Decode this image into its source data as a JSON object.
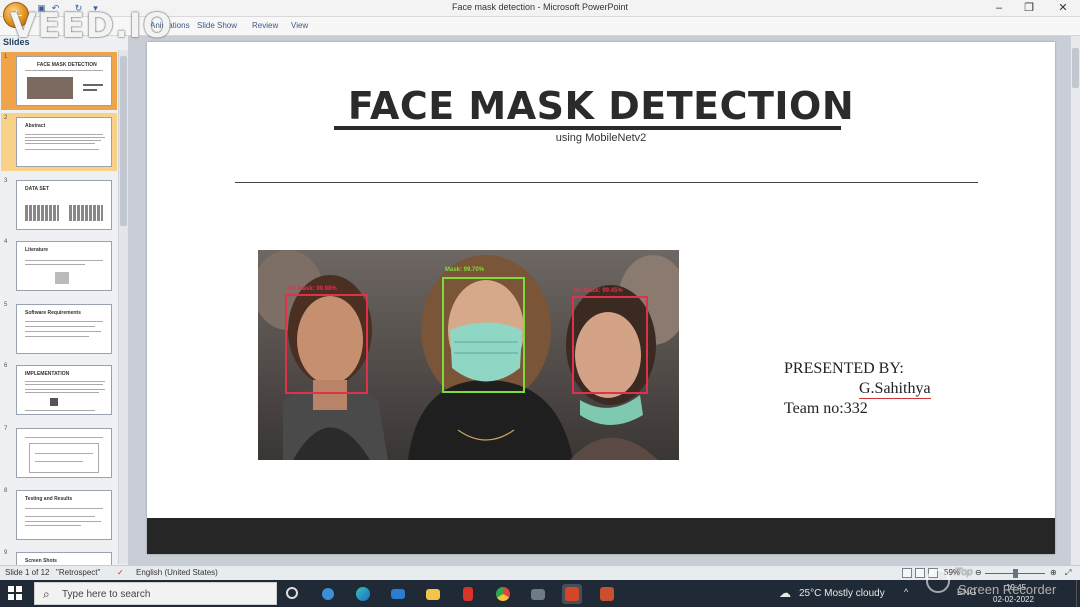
{
  "window": {
    "title": "Face mask detection - Microsoft PowerPoint",
    "controls": [
      "minimize-icon",
      "restore-icon",
      "close-icon"
    ]
  },
  "ribbon": {
    "tabs": [
      {
        "label": "Animations"
      },
      {
        "label": "Slide Show"
      },
      {
        "label": "Review"
      },
      {
        "label": "View"
      }
    ],
    "watermark": "VEED.IO"
  },
  "slide_panel": {
    "tab_label": "Slides",
    "thumbnails": [
      {
        "num": "1",
        "title": "FACE MASK DETECTION"
      },
      {
        "num": "2",
        "title": "Abstract"
      },
      {
        "num": "3",
        "title": "DATA SET"
      },
      {
        "num": "4",
        "title": "Literature"
      },
      {
        "num": "5",
        "title": "Software Requirements"
      },
      {
        "num": "6",
        "title": "IMPLEMENTATION"
      },
      {
        "num": "7",
        "title": ""
      },
      {
        "num": "8",
        "title": "Testing and Results"
      },
      {
        "num": "9",
        "title": "Screen Shots"
      }
    ]
  },
  "slide": {
    "title": "FACE MASK DETECTION",
    "subtitle": "using MobileNetv2",
    "presented_by": "PRESENTED BY:",
    "presenter": "G.Sahithya",
    "team": "Team no:332",
    "image": {
      "boxes": [
        {
          "label": "No Mask: 99.98%",
          "color": "#e0314b"
        },
        {
          "label": "Mask: 99.70%",
          "color": "#7ddc3a"
        },
        {
          "label": "No Mask: 99.45%",
          "color": "#e0314b"
        }
      ]
    }
  },
  "status_bar": {
    "slide_counter": "Slide 1 of 12",
    "theme": "\"Retrospect\"",
    "language": "English (United States)",
    "zoom": "59%"
  },
  "taskbar": {
    "search_placeholder": "Type here to search",
    "weather": "25°C  Mostly cloudy",
    "language": "ENG",
    "time": "19:45",
    "date": "02-02-2022",
    "recorder_line1": "iTop",
    "recorder_line2": "Screen Recorder"
  },
  "colors": {
    "accent": "#f0a44a",
    "slide_dark": "#262626",
    "taskbar": "#1f2a36"
  }
}
